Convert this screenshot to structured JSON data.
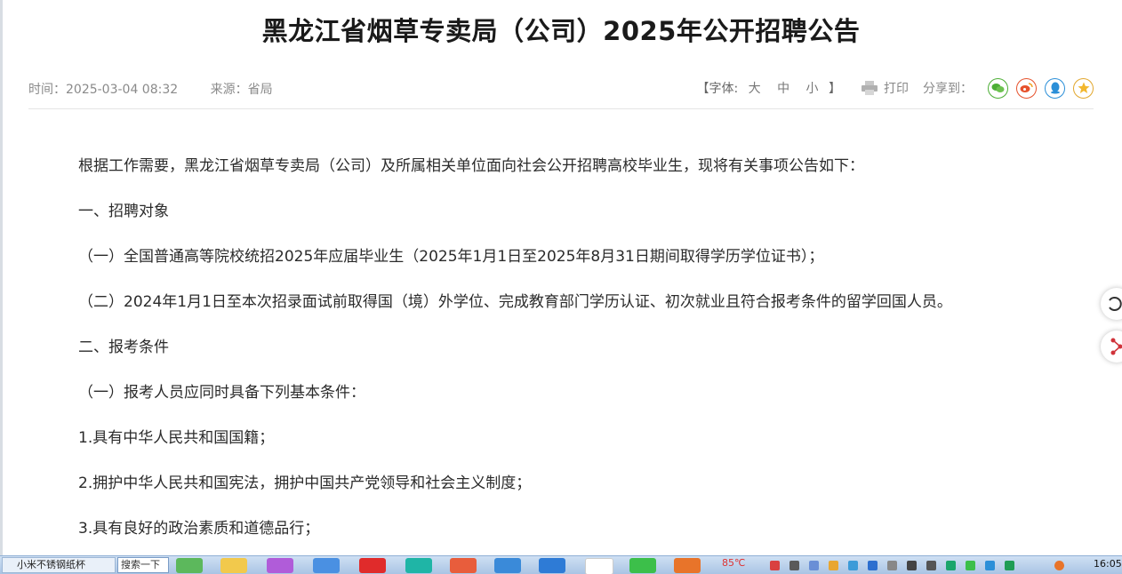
{
  "article": {
    "title": "黑龙江省烟草专卖局（公司）2025年公开招聘公告",
    "time": "时间：2025-03-04 08:32",
    "source": "来源：省局"
  },
  "toolbar": {
    "font_open": "【字体:",
    "font_large": "大",
    "font_medium": "中",
    "font_small": "小",
    "font_close": "】",
    "print_label": "打印",
    "share_label": "分享到：",
    "share_icons": [
      "wechat-icon",
      "weibo-icon",
      "qq-icon",
      "qzone-icon"
    ],
    "share_colors": [
      "#4cae35",
      "#e6522c",
      "#2b8fd8",
      "#e2a72d"
    ]
  },
  "content": {
    "paragraphs": [
      "根据工作需要，黑龙江省烟草专卖局（公司）及所属相关单位面向社会公开招聘高校毕业生，现将有关事项公告如下：",
      "一、招聘对象",
      "（一）全国普通高等院校统招2025年应届毕业生（2025年1月1日至2025年8月31日期间取得学历学位证书）；",
      "（二）2024年1月1日至本次招录面试前取得国（境）外学位、完成教育部门学历认证、初次就业且符合报考条件的留学回国人员。",
      "二、报考条件",
      "（一）报考人员应同时具备下列基本条件：",
      "1.具有中华人民共和国国籍；",
      "2.拥护中华人民共和国宪法，拥护中国共产党领导和社会主义制度；",
      "3.具有良好的政治素质和道德品行；"
    ]
  },
  "taskbar": {
    "task_label": "小米不锈钢纸杯",
    "search_label": "搜索一下",
    "temperature": "85℃",
    "clock": "16:05"
  }
}
